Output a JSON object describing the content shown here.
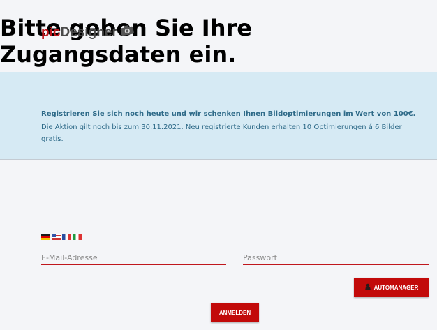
{
  "logo": {
    "part1": "pic",
    "part2": "Designer",
    "icon": "camera-icon"
  },
  "banner": {
    "title": "Bitte geben Sie Ihre Zugangsdaten ein.",
    "promo_bold": "Registrieren Sie sich noch heute und wir schenken Ihnen Bildoptimierungen im Wert von 100€.",
    "promo_text": "Die Aktion gilt noch bis zum 30.11.2021. Neu registrierte Kunden erhalten 10 Optimierungen á 6 Bilder gratis."
  },
  "languages": [
    "de",
    "en",
    "fr",
    "it"
  ],
  "form": {
    "email_placeholder": "E-Mail-Adresse",
    "password_placeholder": "Passwort",
    "automanager_label": "AUTOMANAGER",
    "login_label": "ANMELDEN"
  },
  "colors": {
    "brand": "#c0171d",
    "banner_bg": "#d6eaf4",
    "banner_text": "#2e6a88",
    "button": "#c20a0a"
  }
}
